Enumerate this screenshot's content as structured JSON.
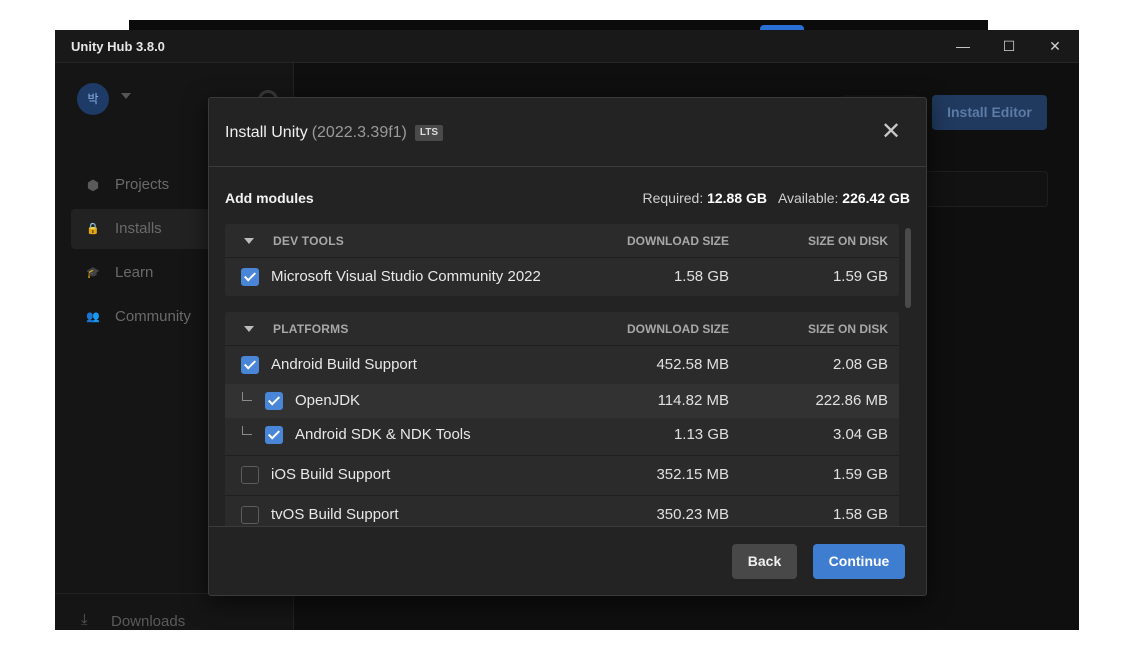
{
  "window": {
    "title": "Unity Hub 3.8.0",
    "min_glyph": "—",
    "max_glyph": "☐",
    "close_glyph": "✕"
  },
  "sidebar": {
    "avatar_initial": "박",
    "items": [
      {
        "label": "Projects",
        "icon": "cube-icon",
        "glyph": "⬢"
      },
      {
        "label": "Installs",
        "icon": "lock-icon",
        "glyph": "🔒"
      },
      {
        "label": "Learn",
        "icon": "graduation-cap-icon",
        "glyph": "🎓"
      },
      {
        "label": "Community",
        "icon": "people-icon",
        "glyph": "👥"
      }
    ],
    "downloads": {
      "label": "Downloads",
      "icon": "download-icon",
      "glyph": "⤓"
    }
  },
  "main": {
    "install_editor_label": "Install Editor"
  },
  "dialog": {
    "title": "Install Unity",
    "version": "(2022.3.39f1)",
    "badge": "LTS",
    "close_glyph": "✕",
    "section_title": "Add modules",
    "required_label": "Required:",
    "required_value": "12.88 GB",
    "available_label": "Available:",
    "available_value": "226.42 GB",
    "groups": [
      {
        "name": "DEV TOOLS",
        "col_download": "DOWNLOAD SIZE",
        "col_disk": "SIZE ON DISK",
        "rows": [
          {
            "label": "Microsoft Visual Studio Community 2022",
            "download": "1.58 GB",
            "disk": "1.59 GB",
            "checked": true
          }
        ]
      },
      {
        "name": "PLATFORMS",
        "col_download": "DOWNLOAD SIZE",
        "col_disk": "SIZE ON DISK",
        "rows": [
          {
            "label": "Android Build Support",
            "download": "452.58 MB",
            "disk": "2.08 GB",
            "checked": true
          },
          {
            "label": "OpenJDK",
            "download": "114.82 MB",
            "disk": "222.86 MB",
            "checked": true,
            "child": true
          },
          {
            "label": "Android SDK & NDK Tools",
            "download": "1.13 GB",
            "disk": "3.04 GB",
            "checked": true,
            "child": true
          },
          {
            "label": "iOS Build Support",
            "download": "352.15 MB",
            "disk": "1.59 GB",
            "checked": false
          },
          {
            "label": "tvOS Build Support",
            "download": "350.23 MB",
            "disk": "1.58 GB",
            "checked": false
          }
        ]
      }
    ],
    "back_label": "Back",
    "continue_label": "Continue"
  },
  "colors": {
    "accent": "#3f7dd1",
    "checkbox": "#4a86d8",
    "dialog_bg": "#232323",
    "group_bg": "#2b2b2b"
  }
}
